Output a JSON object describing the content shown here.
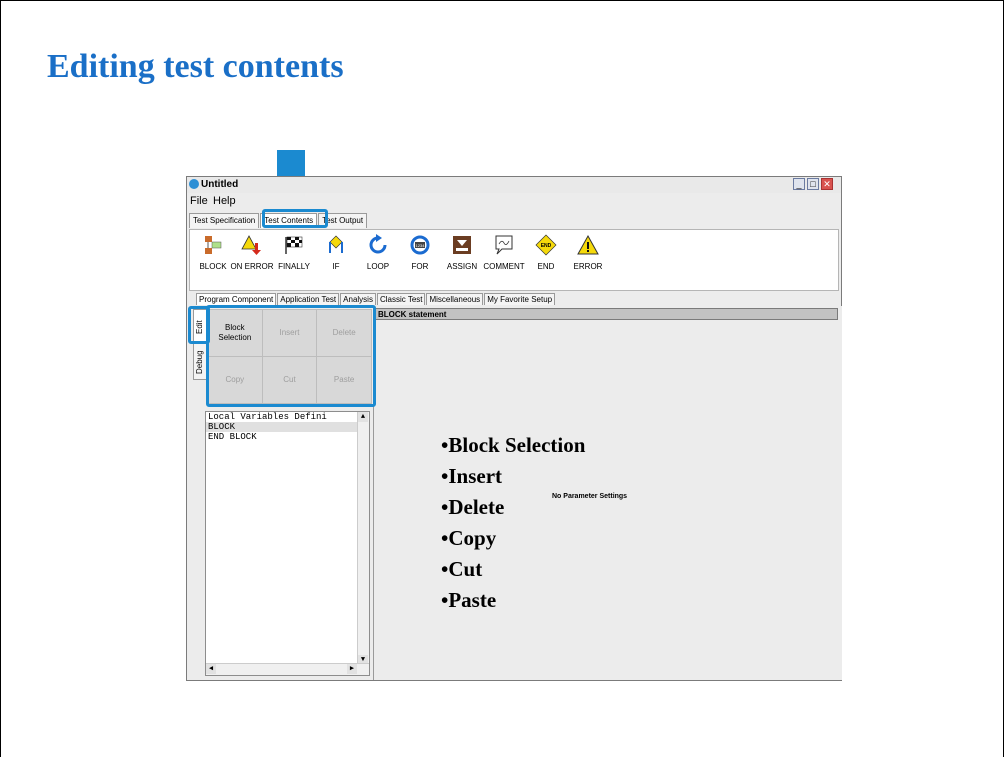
{
  "slide": {
    "title": "Editing test contents"
  },
  "window": {
    "title": "Untitled",
    "menus": [
      "File",
      "Help"
    ],
    "main_tabs": [
      "Test Specification",
      "Test Contents",
      "Test Output"
    ],
    "toolbar_items": [
      {
        "label": "BLOCK",
        "icon": "block-icon"
      },
      {
        "label": "ON ERROR",
        "icon": "on-error-icon"
      },
      {
        "label": "FINALLY",
        "icon": "finally-icon"
      },
      {
        "label": "IF",
        "icon": "if-icon"
      },
      {
        "label": "LOOP",
        "icon": "loop-icon"
      },
      {
        "label": "FOR",
        "icon": "for-icon"
      },
      {
        "label": "ASSIGN",
        "icon": "assign-icon"
      },
      {
        "label": "COMMENT",
        "icon": "comment-icon"
      },
      {
        "label": "END",
        "icon": "end-icon"
      },
      {
        "label": "ERROR",
        "icon": "error-icon"
      }
    ],
    "sub_tabs": [
      "Program Component",
      "Application Test",
      "Analysis",
      "Classic Test",
      "Miscellaneous",
      "My Favorite Setup"
    ],
    "side_tabs": [
      "Edit",
      "Debug"
    ],
    "edit_buttons": [
      {
        "label": "Block Selection",
        "enabled": true
      },
      {
        "label": "Insert",
        "enabled": false
      },
      {
        "label": "Delete",
        "enabled": false
      },
      {
        "label": "Copy",
        "enabled": false
      },
      {
        "label": "Cut",
        "enabled": false
      },
      {
        "label": "Paste",
        "enabled": false
      }
    ],
    "code_lines": [
      "Local Variables Defini",
      "BLOCK",
      "END BLOCK"
    ],
    "statement_header": "BLOCK statement",
    "parameter_text": "No Parameter Settings"
  },
  "bullets": [
    "•Block Selection",
    "•Insert",
    "•Delete",
    "•Copy",
    "•Cut",
    "•Paste"
  ],
  "colors": {
    "title": "#1a6fc7",
    "highlight": "#1b8ad0"
  }
}
